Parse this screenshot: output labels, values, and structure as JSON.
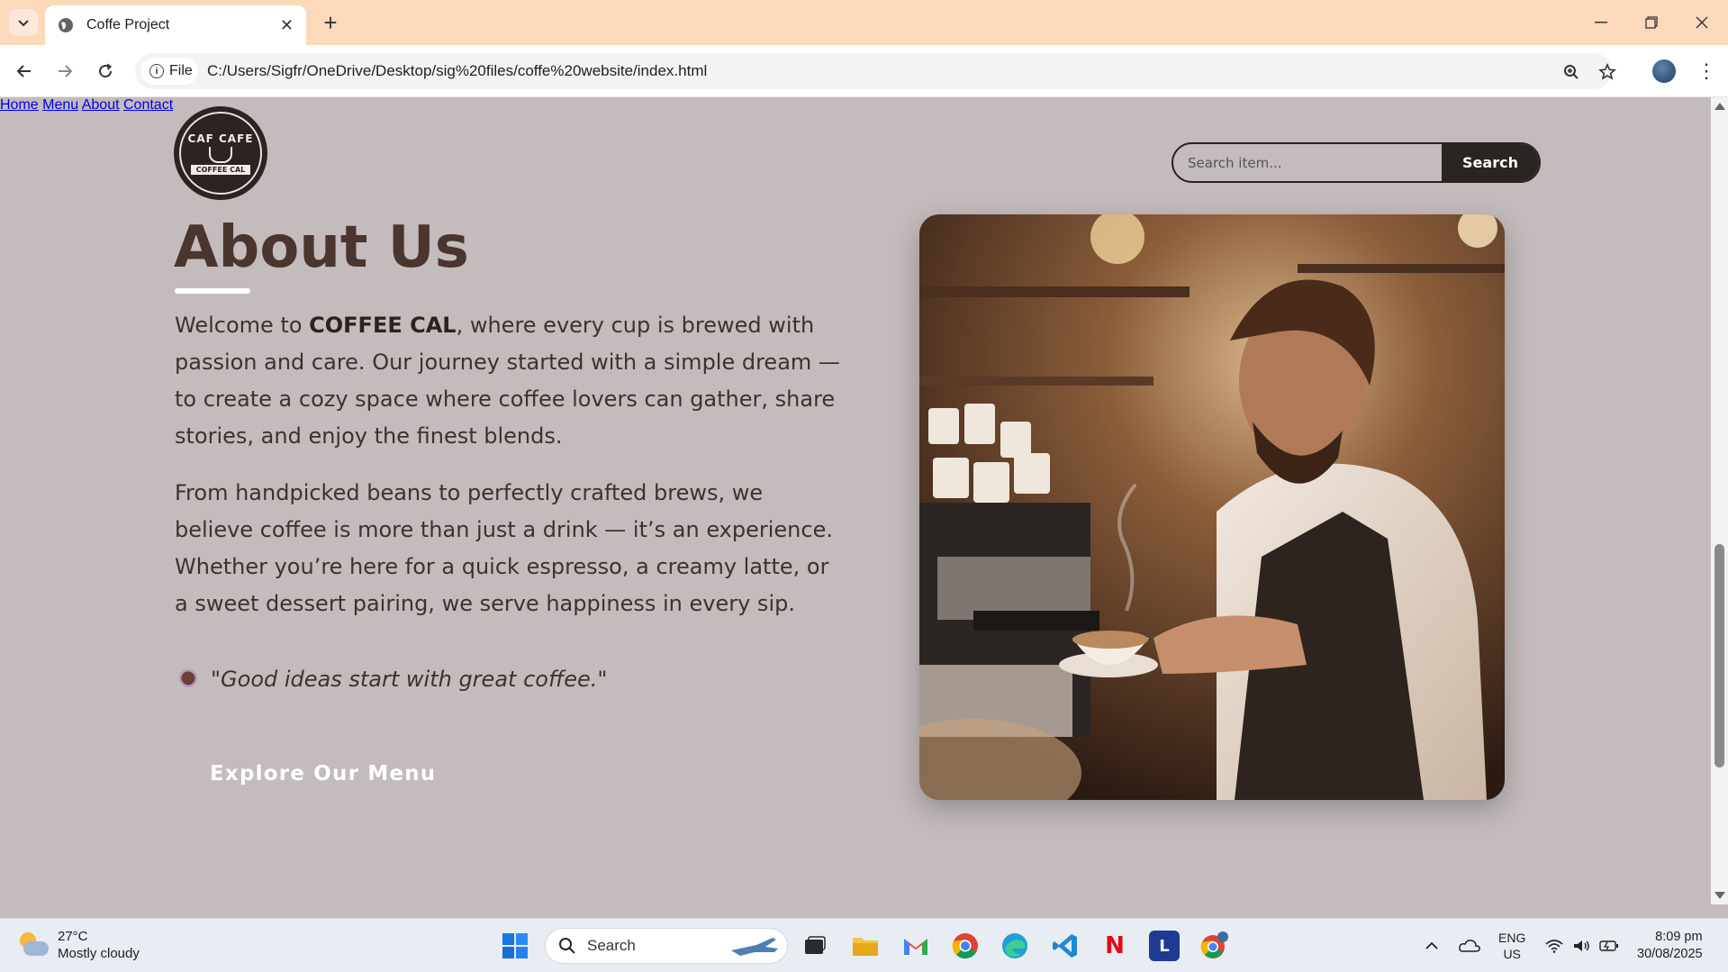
{
  "browser": {
    "tab_title": "Coffe Project",
    "file_chip": "File",
    "url": "C:/Users/Sigfr/OneDrive/Desktop/sig%20files/coffe%20website/index.html"
  },
  "site": {
    "logo": {
      "arc_text": "CAF CAFE",
      "banner_text": "COFFEE CAL"
    },
    "nav": [
      {
        "label": "Home"
      },
      {
        "label": "Menu"
      },
      {
        "label": "About"
      },
      {
        "label": "Contact"
      }
    ],
    "search": {
      "placeholder": "Search item...",
      "button_label": "Search"
    }
  },
  "about": {
    "title": "About Us",
    "p1_before": "Welcome to ",
    "p1_brand": "COFFEE CAL",
    "p1_after": ", where every cup is brewed with passion and care. Our journey started with a simple dream — to create a cozy space where coffee lovers can gather, share stories, and enjoy the finest blends.",
    "p2": "From handpicked beans to perfectly crafted brews, we believe coffee is more than just a drink — it’s an experience. Whether you’re here for a quick espresso, a creamy latte, or a sweet dessert pairing, we serve happiness in every sip.",
    "quote": "\"Good ideas start with great coffee.\"",
    "cta_label": "Explore Our Menu"
  },
  "taskbar": {
    "weather_temp": "27°C",
    "weather_desc": "Mostly cloudy",
    "search_label": "Search",
    "lang_top": "ENG",
    "lang_bottom": "US",
    "time": "8:09 pm",
    "date": "30/08/2025"
  },
  "colors": {
    "page_bg": "#c3bbbc",
    "heading": "#4a3530",
    "search_button_bg": "#2a2422",
    "tab_strip": "#fdd9bc"
  }
}
